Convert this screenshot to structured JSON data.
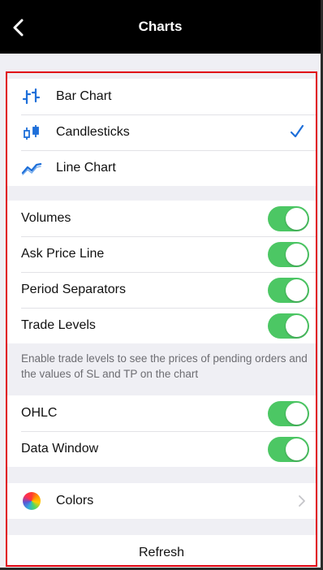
{
  "header": {
    "title": "Charts"
  },
  "chart_types": [
    {
      "label": "Bar Chart",
      "icon": "bar-chart-icon",
      "selected": false
    },
    {
      "label": "Candlesticks",
      "icon": "candlesticks-icon",
      "selected": true
    },
    {
      "label": "Line Chart",
      "icon": "line-chart-icon",
      "selected": false
    }
  ],
  "toggles_main": [
    {
      "label": "Volumes",
      "on": true
    },
    {
      "label": "Ask Price Line",
      "on": true
    },
    {
      "label": "Period Separators",
      "on": true
    },
    {
      "label": "Trade Levels",
      "on": true
    }
  ],
  "trade_levels_note": "Enable trade levels to see the prices of pending orders and the values of SL and TP on the chart",
  "toggles_secondary": [
    {
      "label": "OHLC",
      "on": true
    },
    {
      "label": "Data Window",
      "on": true
    }
  ],
  "colors_row": {
    "label": "Colors"
  },
  "refresh_row": {
    "label": "Refresh"
  },
  "colors": {
    "accent": "#1e6fd9",
    "toggle_on": "#4cc764",
    "highlight_border": "#e0000f",
    "navbar": "#000000"
  }
}
